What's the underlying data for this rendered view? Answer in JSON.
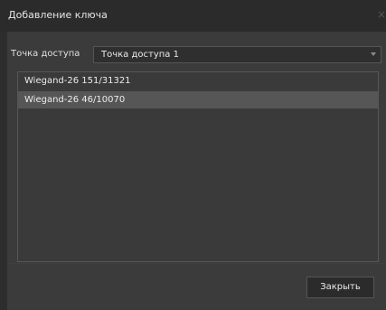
{
  "window": {
    "title": "Добавление ключа",
    "close_glyph": "×"
  },
  "access_point": {
    "label": "Точка доступа",
    "selected": "Точка доступа 1"
  },
  "key_list": {
    "items": [
      {
        "label": "Wiegand-26 151/31321",
        "selected": false
      },
      {
        "label": "Wiegand-26 46/10070",
        "selected": true
      }
    ]
  },
  "footer": {
    "close_label": "Закрыть"
  },
  "colors": {
    "titlebar": "#2b2b2b",
    "body": "#3b3b3b",
    "selected_row": "#565656",
    "text": "#ececec"
  }
}
